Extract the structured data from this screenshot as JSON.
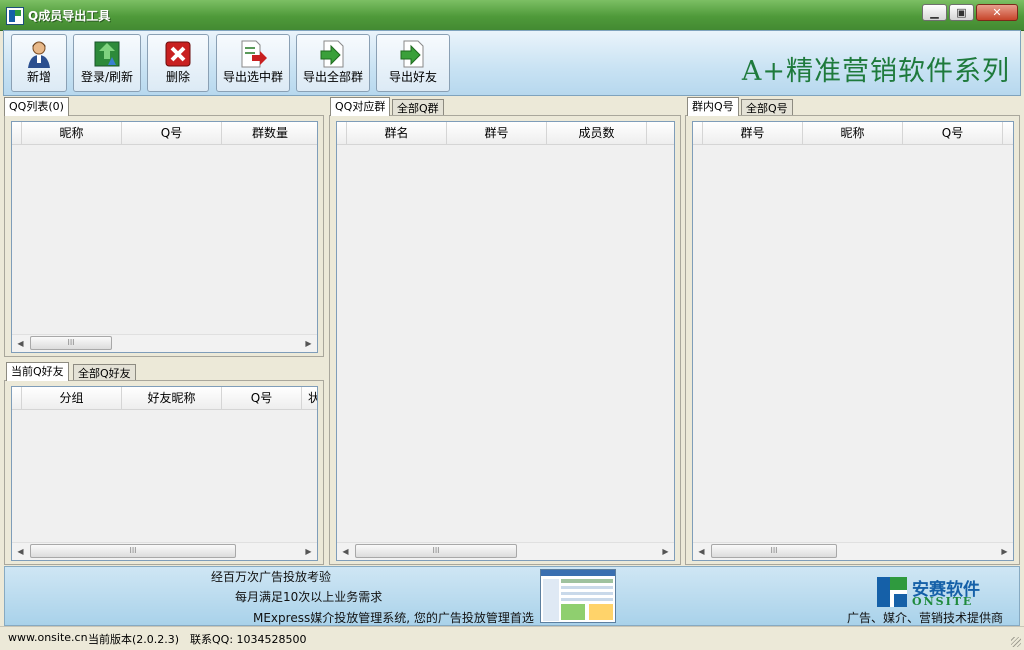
{
  "window": {
    "title": "Q成员导出工具",
    "minimize": "0",
    "maximize": "1",
    "close": "r"
  },
  "toolbar": {
    "buttons": [
      {
        "label": "新增",
        "icon": "add-user-icon"
      },
      {
        "label": "登录/刷新",
        "icon": "refresh-icon"
      },
      {
        "label": "删除",
        "icon": "delete-icon"
      },
      {
        "label": "导出选中群",
        "icon": "export-selected-icon"
      },
      {
        "label": "导出全部群",
        "icon": "export-all-icon"
      },
      {
        "label": "导出好友",
        "icon": "export-friends-icon"
      }
    ],
    "slogan": "A+精准营销软件系列"
  },
  "qq_list_panel": {
    "tab": "QQ列表(0)",
    "columns": [
      "昵称",
      "Q号",
      "群数量"
    ]
  },
  "friends_panel": {
    "tabs": [
      "当前Q好友",
      "全部Q好友"
    ],
    "columns": [
      "分组",
      "好友昵称",
      "Q号",
      "状"
    ]
  },
  "groups_panel": {
    "tabs": [
      "QQ对应群",
      "全部Q群"
    ],
    "columns": [
      "群名",
      "群号",
      "成员数"
    ]
  },
  "members_panel": {
    "tabs": [
      "群内Q号",
      "全部Q号"
    ],
    "columns": [
      "群号",
      "昵称",
      "Q号"
    ]
  },
  "scroll": {
    "thumb_grip": "III",
    "left_arrow": "◀",
    "right_arrow": "▶"
  },
  "banner": {
    "line1": "经百万次广告投放考验",
    "line2": "每月满足10次以上业务需求",
    "line3": "MExpress媒介投放管理系统, 您的广告投放管理首选",
    "logo_cn": "安赛软件",
    "logo_en": "ONSITE",
    "logo_tagline": "广告、媒介、营销技术提供商"
  },
  "status": {
    "website": "www.onsite.cn",
    "version": "当前版本(2.0.2.3)",
    "contact": "联系QQ: 1034528500"
  },
  "colors": {
    "title_green": "#4f9a3a",
    "slogan_green": "#1e7a3c",
    "brand_blue": "#1560a8",
    "banner_blue": "#a9d2ea"
  }
}
